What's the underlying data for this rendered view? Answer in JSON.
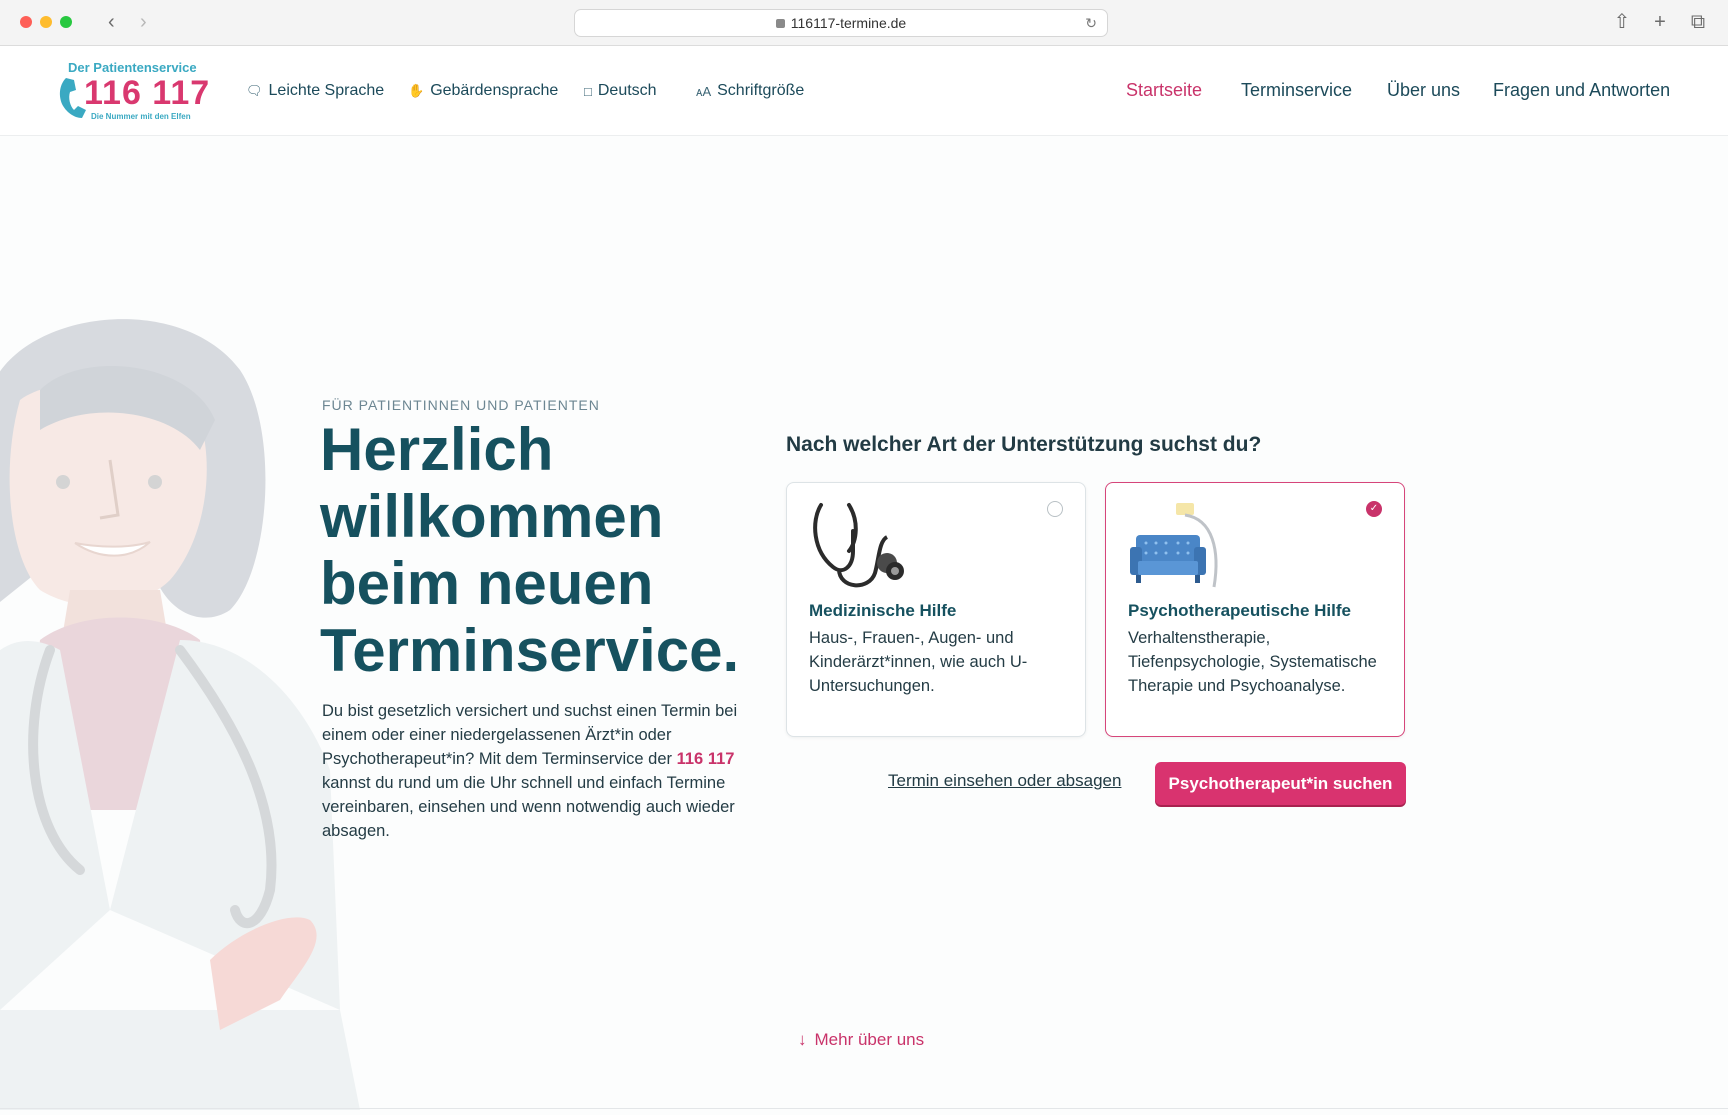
{
  "browser": {
    "url": "116117-termine.de"
  },
  "logo": {
    "top": "Der Patientenservice",
    "number": "116 117",
    "sub": "Die Nummer mit den Elfen"
  },
  "utility_nav": [
    {
      "label": "Leichte Sprache",
      "icon": "speech-bubble-icon"
    },
    {
      "label": "Gebärdensprache",
      "icon": "hand-icon"
    },
    {
      "label": "Deutsch",
      "icon": "chat-icon"
    },
    {
      "label": "Schriftgröße",
      "icon": "font-size-icon"
    }
  ],
  "main_nav": [
    {
      "label": "Startseite",
      "active": true
    },
    {
      "label": "Terminservice",
      "active": false
    },
    {
      "label": "Über uns",
      "active": false
    },
    {
      "label": "Fragen und Antworten",
      "active": false
    }
  ],
  "hero": {
    "eyebrow": "FÜR PATIENTINNEN UND PATIENTEN",
    "title": "Herzlich willkommen beim neuen Terminservice.",
    "desc_before": "Du bist gesetzlich versichert und suchst einen Termin bei einem oder einer niedergelassenen Ärzt*in oder Psychotherapeut*in? Mit dem Terminservice der ",
    "desc_brand": "116 117",
    "desc_after": " kannst du rund um die Uhr schnell und einfach Termine vereinbaren, einsehen und wenn notwendig auch wieder absagen."
  },
  "selection": {
    "question": "Nach welcher Art der Unterstützung suchst du?",
    "options": [
      {
        "title": "Medizinische Hilfe",
        "desc": "Haus-, Frauen-, Augen- und Kinderärzt*innen, wie auch U-Untersuchungen.",
        "icon": "stethoscope-icon",
        "selected": false
      },
      {
        "title": "Psychotherapeutische Hilfe",
        "desc": "Verhaltenstherapie, Tiefenpsychologie, Systematische Therapie und Psychoanalyse.",
        "icon": "couch-icon",
        "selected": true
      }
    ],
    "secondary_link": "Termin einsehen oder absagen",
    "primary_button": "Psychotherapeut*in suchen"
  },
  "more_link": "Mehr über uns",
  "colors": {
    "brand_pink": "#d9336f",
    "brand_teal": "#16515f",
    "accent_blue": "#3aa9c2"
  }
}
